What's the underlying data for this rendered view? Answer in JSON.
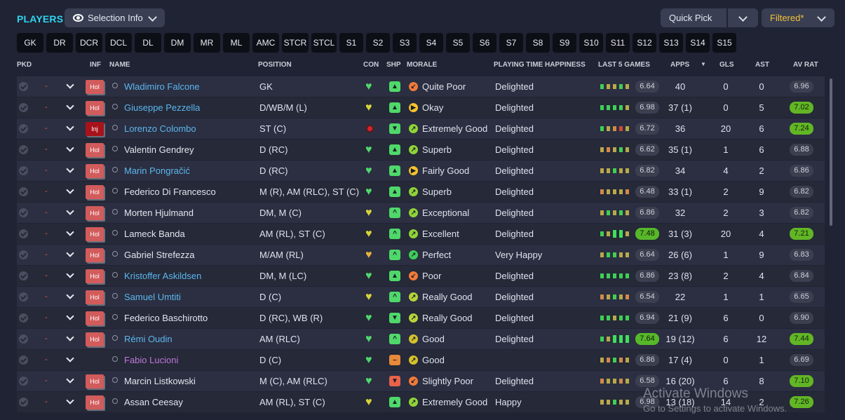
{
  "header": {
    "title": "PLAYERS",
    "selection_info_label": "Selection Info",
    "quick_pick_label": "Quick Pick",
    "filtered_label": "Filtered*"
  },
  "filters": [
    "GK",
    "DR",
    "DCR",
    "DCL",
    "DL",
    "DM",
    "MR",
    "ML",
    "AMC",
    "STCR",
    "STCL",
    "S1",
    "S2",
    "S3",
    "S4",
    "S5",
    "S6",
    "S7",
    "S8",
    "S9",
    "S10",
    "S11",
    "S12",
    "S13",
    "S14",
    "S15"
  ],
  "columns": {
    "pkd": "PKD",
    "inf": "INF",
    "name": "NAME",
    "position": "POSITION",
    "con": "CON",
    "shp": "SHP",
    "morale": "MORALE",
    "happiness": "PLAYING TIME HAPPINESS",
    "last5": "LAST 5 GAMES",
    "apps": "APPS",
    "gls": "GLS",
    "ast": "AST",
    "avrat": "AV RAT"
  },
  "colors": {
    "accent_title": "#2fd4f0",
    "good_green": "#57b82a",
    "injury_red": "#a8121b",
    "holiday_red": "#d25b5b",
    "link_blue": "#5cb6ee",
    "loan_purple": "#c076d8"
  },
  "players": [
    {
      "inf": "Hol",
      "name": "Wladimiro Falcone",
      "name_color": "blue",
      "position": "GK",
      "con": "green",
      "shp": "green-up",
      "morale": "Quite Poor",
      "morale_color": "#f07a3a",
      "morale_icon": "down-arrow",
      "happiness": "Delighted",
      "last5": [
        "g",
        "y",
        "y",
        "g",
        "y"
      ],
      "form_avg": "6.64",
      "form_hi": false,
      "apps": "40",
      "gls": "0",
      "ast": "0",
      "avrat": "6.96",
      "avrat_hi": false
    },
    {
      "inf": "Hol",
      "name": "Giuseppe Pezzella",
      "name_color": "blue",
      "position": "D/WB/M (L)",
      "con": "yellow",
      "shp": "green-up",
      "morale": "Okay",
      "morale_color": "#f5c32c",
      "morale_icon": "right-arrow",
      "happiness": "Delighted",
      "last5": [
        "g",
        "g",
        "g",
        "g",
        "y"
      ],
      "form_avg": "6.98",
      "form_hi": false,
      "apps": "37 (1)",
      "gls": "0",
      "ast": "5",
      "avrat": "7.02",
      "avrat_hi": true
    },
    {
      "inf": "Inj",
      "name": "Lorenzo Colombo",
      "name_color": "blue",
      "position": "ST (C)",
      "con": "injured",
      "shp": "green-down",
      "morale": "Extremely Good",
      "morale_color": "#8fd338",
      "morale_icon": "up-arrow",
      "happiness": "Delighted",
      "last5": [
        "g",
        "y",
        "o",
        "r",
        "y"
      ],
      "form_avg": "6.72",
      "form_hi": false,
      "apps": "36",
      "gls": "20",
      "ast": "6",
      "avrat": "7.24",
      "avrat_hi": true
    },
    {
      "inf": "Hol",
      "name": "Valentin Gendrey",
      "name_color": "white",
      "position": "D (RC)",
      "con": "green",
      "shp": "green-up",
      "morale": "Superb",
      "morale_color": "#8fd338",
      "morale_icon": "up-arrow",
      "happiness": "Delighted",
      "last5": [
        "y",
        "o",
        "y",
        "g",
        "y"
      ],
      "form_avg": "6.62",
      "form_hi": false,
      "apps": "35 (1)",
      "gls": "1",
      "ast": "6",
      "avrat": "6.88",
      "avrat_hi": false
    },
    {
      "inf": "Hol",
      "name": "Marin Pongračić",
      "name_color": "blue",
      "position": "D (RC)",
      "con": "green",
      "shp": "green-up",
      "morale": "Fairly Good",
      "morale_color": "#f5c32c",
      "morale_icon": "right-arrow",
      "happiness": "Delighted",
      "last5": [
        "y",
        "y",
        "g",
        "y",
        "y"
      ],
      "form_avg": "6.82",
      "form_hi": false,
      "apps": "34",
      "gls": "4",
      "ast": "2",
      "avrat": "6.86",
      "avrat_hi": false
    },
    {
      "inf": "Hol",
      "name": "Federico Di Francesco",
      "name_color": "white",
      "position": "M (R), AM (RLC), ST (C)",
      "con": "green",
      "shp": "green-up",
      "morale": "Superb",
      "morale_color": "#8fd338",
      "morale_icon": "up-arrow",
      "happiness": "Delighted",
      "last5": [
        "o",
        "y",
        "y",
        "y",
        "o"
      ],
      "form_avg": "6.48",
      "form_hi": false,
      "apps": "33 (1)",
      "gls": "2",
      "ast": "9",
      "avrat": "6.82",
      "avrat_hi": false
    },
    {
      "inf": "Hol",
      "name": "Morten Hjulmand",
      "name_color": "white",
      "position": "DM, M (C)",
      "con": "yellow",
      "shp": "green-caret",
      "morale": "Exceptional",
      "morale_color": "#8fd338",
      "morale_icon": "up-arrow",
      "happiness": "Delighted",
      "last5": [
        "y",
        "g",
        "y",
        "g",
        "y"
      ],
      "form_avg": "6.86",
      "form_hi": false,
      "apps": "32",
      "gls": "2",
      "ast": "3",
      "avrat": "6.82",
      "avrat_hi": false
    },
    {
      "inf": "Hol",
      "name": "Lameck Banda",
      "name_color": "white",
      "position": "AM (RL), ST (C)",
      "con": "yellow",
      "shp": "green-caret",
      "morale": "Excellent",
      "morale_color": "#8fd338",
      "morale_icon": "up-arrow",
      "happiness": "Delighted",
      "last5": [
        "g",
        "y",
        "G",
        "G",
        "y"
      ],
      "form_avg": "7.48",
      "form_hi": true,
      "apps": "31 (3)",
      "gls": "20",
      "ast": "4",
      "avrat": "7.21",
      "avrat_hi": true
    },
    {
      "inf": "Hol",
      "name": "Gabriel Strefezza",
      "name_color": "white",
      "position": "M/AM (RL)",
      "con": "orange",
      "shp": "green-caret",
      "morale": "Perfect",
      "morale_color": "#3ecf5a",
      "morale_icon": "up-arrow",
      "happiness": "Very Happy",
      "last5": [
        "y",
        "g",
        "g",
        "y",
        "y"
      ],
      "form_avg": "6.64",
      "form_hi": false,
      "apps": "26 (6)",
      "gls": "1",
      "ast": "9",
      "avrat": "6.83",
      "avrat_hi": false
    },
    {
      "inf": "Hol",
      "name": "Kristoffer Askildsen",
      "name_color": "blue",
      "position": "DM, M (LC)",
      "con": "green",
      "shp": "green-up",
      "morale": "Poor",
      "morale_color": "#f07a3a",
      "morale_icon": "down-arrow",
      "happiness": "Delighted",
      "last5": [
        "g",
        "g",
        "g",
        "g",
        "g"
      ],
      "form_avg": "6.86",
      "form_hi": false,
      "apps": "23 (8)",
      "gls": "2",
      "ast": "4",
      "avrat": "6.84",
      "avrat_hi": false
    },
    {
      "inf": "Hol",
      "name": "Samuel Umtiti",
      "name_color": "blue",
      "position": "D (C)",
      "con": "yellow",
      "shp": "green-caret",
      "morale": "Really Good",
      "morale_color": "#b6d43a",
      "morale_icon": "up-arrow",
      "happiness": "Delighted",
      "last5": [
        "o",
        "y",
        "g",
        "y",
        "o"
      ],
      "form_avg": "6.54",
      "form_hi": false,
      "apps": "22",
      "gls": "1",
      "ast": "1",
      "avrat": "6.65",
      "avrat_hi": false
    },
    {
      "inf": "Hol",
      "name": "Federico Baschirotto",
      "name_color": "white",
      "position": "D (RC), WB (R)",
      "con": "green",
      "shp": "green-down",
      "morale": "Really Good",
      "morale_color": "#b6d43a",
      "morale_icon": "up-arrow",
      "happiness": "Delighted",
      "last5": [
        "g",
        "g",
        "y",
        "g",
        "g"
      ],
      "form_avg": "6.94",
      "form_hi": false,
      "apps": "21 (9)",
      "gls": "6",
      "ast": "0",
      "avrat": "6.90",
      "avrat_hi": false
    },
    {
      "inf": "Hol",
      "name": "Rémi Oudin",
      "name_color": "blue",
      "position": "AM (RLC)",
      "con": "green",
      "shp": "green-caret",
      "morale": "Good",
      "morale_color": "#d4c12c",
      "morale_icon": "up-arrow",
      "happiness": "Delighted",
      "last5": [
        "g",
        "y",
        "G",
        "G",
        "G"
      ],
      "form_avg": "7.64",
      "form_hi": true,
      "apps": "19 (12)",
      "gls": "6",
      "ast": "12",
      "avrat": "7.44",
      "avrat_hi": true
    },
    {
      "inf": "",
      "name": "Fabio Lucioni",
      "name_color": "purple",
      "position": "D (C)",
      "con": "green",
      "shp": "orange-dash",
      "morale": "Good",
      "morale_color": "#d4c12c",
      "morale_icon": "up-arrow",
      "happiness": "",
      "last5": [
        "y",
        "o",
        "g",
        "o",
        "y"
      ],
      "form_avg": "6.86",
      "form_hi": false,
      "apps": "17 (4)",
      "gls": "0",
      "ast": "1",
      "avrat": "6.69",
      "avrat_hi": false
    },
    {
      "inf": "Hol",
      "name": "Marcin Listkowski",
      "name_color": "white",
      "position": "M (C), AM (RLC)",
      "con": "green",
      "shp": "red-down",
      "morale": "Slightly Poor",
      "morale_color": "#f07a3a",
      "morale_icon": "down-arrow",
      "happiness": "Delighted",
      "last5": [
        "o",
        "y",
        "y",
        "o",
        "y"
      ],
      "form_avg": "6.58",
      "form_hi": false,
      "apps": "16 (20)",
      "gls": "6",
      "ast": "8",
      "avrat": "7.10",
      "avrat_hi": true
    },
    {
      "inf": "Hol",
      "name": "Assan Ceesay",
      "name_color": "white",
      "position": "AM (RL), ST (C)",
      "con": "yellow",
      "shp": "green-up",
      "morale": "Extremely Good",
      "morale_color": "#8fd338",
      "morale_icon": "up-arrow",
      "happiness": "Happy",
      "last5": [
        "y",
        "y",
        "g",
        "y",
        "y"
      ],
      "form_avg": "6.98",
      "form_hi": false,
      "apps": "13 (18)",
      "gls": "14",
      "ast": "2",
      "avrat": "7.26",
      "avrat_hi": true
    }
  ],
  "watermark": {
    "line1": "Activate Windows",
    "line2": "Go to Settings to activate Windows."
  }
}
